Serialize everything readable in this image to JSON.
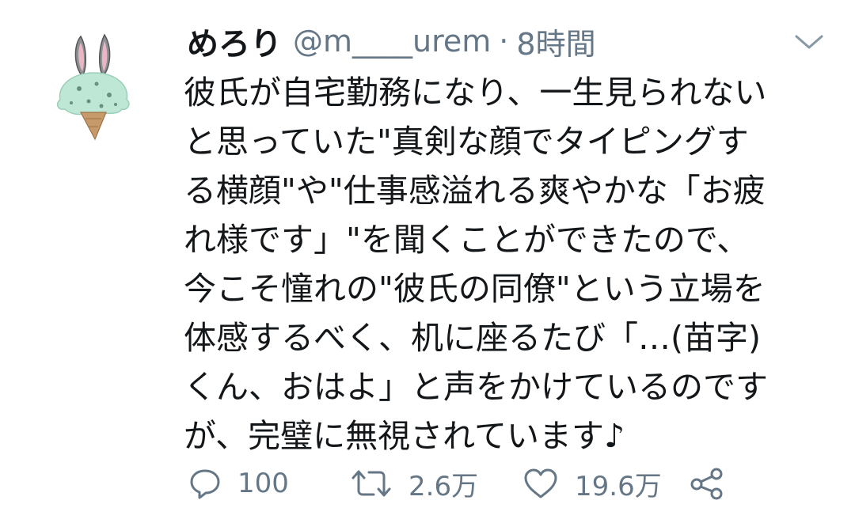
{
  "tweet": {
    "display_name": "めろり",
    "handle": "@m____urem",
    "separator": "·",
    "timestamp": "8時間",
    "lines": [
      "彼氏が自宅勤務になり、一生見られない",
      "と思っていた\"真剣な顔でタイピングす",
      "る横顔\"や\"仕事感溢れる爽やかな「お疲",
      "れ様です」\"を聞くことができたので、",
      "今こそ憧れの\"彼氏の同僚\"という立場を",
      "体感するべく、机に座るたび「…(苗字)",
      "くん、おはよ」と声をかけているのです",
      "が、完璧に無視されています♪"
    ],
    "actions": {
      "reply_count": "100",
      "retweet_count": "2.6万",
      "like_count": "19.6万"
    }
  },
  "icons": {
    "avatar": "bunny-ice-cream-avatar",
    "caret": "chevron-down-icon",
    "reply": "reply-icon",
    "retweet": "retweet-icon",
    "like": "heart-icon",
    "share": "share-icon"
  },
  "colors": {
    "text": "#14171a",
    "secondary": "#657786",
    "avatar_mint": "#bfe7d6",
    "avatar_cone": "#c79a6b"
  }
}
